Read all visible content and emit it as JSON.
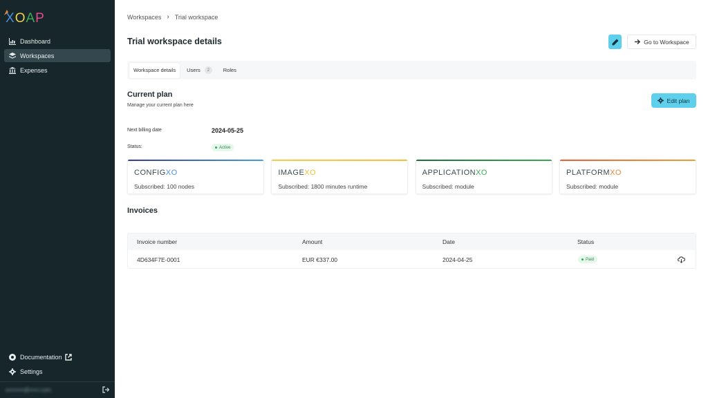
{
  "app": {
    "logo_text": "XOAP",
    "colors": {
      "sidebar_bg": "#16262b",
      "accent": "#5fd0ec"
    }
  },
  "sidebar": {
    "items": [
      {
        "label": "Dashboard",
        "icon": "chart-icon",
        "active": false
      },
      {
        "label": "Workspaces",
        "icon": "layers-icon",
        "active": true
      },
      {
        "label": "Expenses",
        "icon": "bank-icon",
        "active": false
      }
    ],
    "bottom": [
      {
        "label": "Documentation",
        "icon": "help-circle-icon"
      },
      {
        "label": "Settings",
        "icon": "gear-icon"
      }
    ],
    "user_email": "s••••••••@•••••.com"
  },
  "breadcrumb": {
    "items": [
      "Workspaces",
      "Trial workspace"
    ]
  },
  "page": {
    "title": "Trial workspace details",
    "go_to_label": "Go to Workspace"
  },
  "tabs": [
    {
      "label": "Workspace details",
      "active": true
    },
    {
      "label": "Users",
      "badge": "2"
    },
    {
      "label": "Roles"
    }
  ],
  "plan": {
    "title": "Current plan",
    "subtitle": "Manage your current plan here",
    "edit_label": "Edit plan",
    "billing_label": "Next billing date",
    "billing_date": "2024-05-25",
    "status_label": "Status:",
    "status_value": "Active"
  },
  "products": [
    {
      "name": "CONFIG",
      "suffix": "XO",
      "subscribed": "Subscribed: 100 nodes",
      "color": "#4a90d9"
    },
    {
      "name": "IMAGE",
      "suffix": "XO",
      "subscribed": "Subscribed: 1800 minutes runtime",
      "color": "#f2d14a"
    },
    {
      "name": "APPLICATION",
      "suffix": "XO",
      "subscribed": "Subscribed: module",
      "color": "#3fa85a"
    },
    {
      "name": "PLATFORM",
      "suffix": "XO",
      "subscribed": "Subscribed: module",
      "color": "#e8843a"
    }
  ],
  "invoices": {
    "title": "Invoices",
    "columns": [
      "Invoice number",
      "Amount",
      "Date",
      "Status"
    ],
    "rows": [
      {
        "number": "4D634F7E-0001",
        "amount": "EUR €337.00",
        "date": "2024-04-25",
        "status": "Paid"
      }
    ]
  }
}
